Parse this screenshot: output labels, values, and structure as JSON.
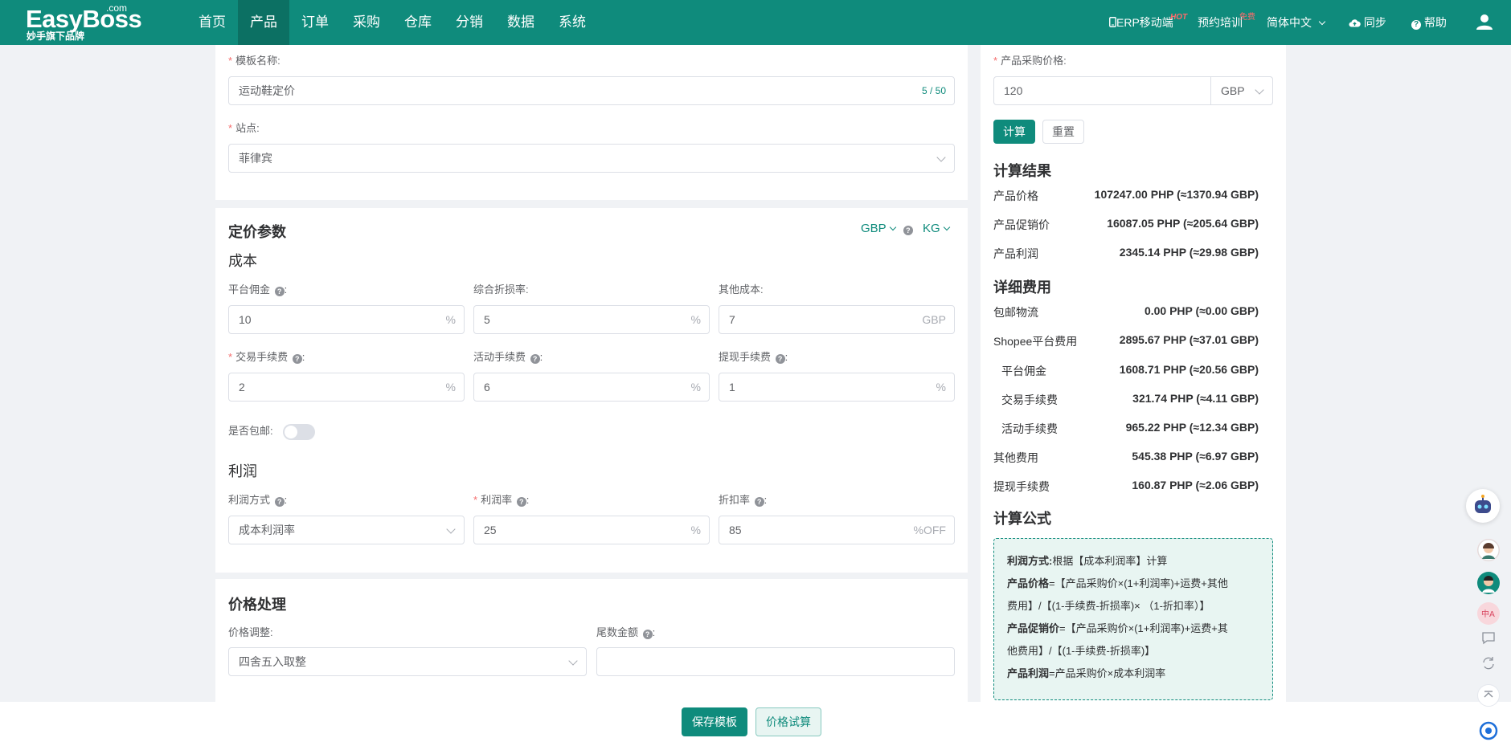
{
  "brand": {
    "name": "EasyBoss",
    "dotcom": ".com",
    "tagline": "妙手旗下品牌"
  },
  "nav": {
    "items": [
      "首页",
      "产品",
      "订单",
      "采购",
      "仓库",
      "分销",
      "数据",
      "系统"
    ],
    "active": "产品"
  },
  "top_right": {
    "erp_mobile": "ERP移动端",
    "erp_badge": "HOT",
    "training": "预约培训",
    "training_badge": "免费",
    "language": "简体中文",
    "sync": "同步",
    "help": "帮助"
  },
  "template": {
    "name_label": "模板名称:",
    "name_value": "运动鞋定价",
    "name_count": "5 / 50",
    "site_label": "站点:",
    "site_value": "菲律宾"
  },
  "pricing": {
    "title": "定价参数",
    "currency": "GBP",
    "weight_unit": "KG",
    "cost_title": "成本",
    "platform_commission": {
      "label": "平台佣金",
      "value": "10",
      "unit": "%"
    },
    "loss_rate": {
      "label": "综合折损率:",
      "value": "5",
      "unit": "%"
    },
    "other_cost": {
      "label": "其他成本:",
      "value": "7",
      "unit": "GBP"
    },
    "transaction_fee": {
      "label": "交易手续费",
      "value": "2",
      "unit": "%"
    },
    "activity_fee": {
      "label": "活动手续费",
      "value": "6",
      "unit": "%"
    },
    "withdraw_fee": {
      "label": "提现手续费",
      "value": "1",
      "unit": "%"
    },
    "free_shipping_label": "是否包邮:",
    "free_shipping_on": false,
    "profit_title": "利润",
    "profit_method": {
      "label": "利润方式",
      "value": "成本利润率"
    },
    "profit_rate": {
      "label": "利润率",
      "value": "25",
      "unit": "%"
    },
    "discount_rate": {
      "label": "折扣率",
      "value": "85",
      "unit": "%OFF"
    }
  },
  "price_processing": {
    "title": "价格处理",
    "adjust_label": "价格调整:",
    "adjust_value": "四舍五入取整",
    "tail_label": "尾数金额",
    "tail_value": ""
  },
  "calculator": {
    "purchase_price_label": "产品采购价格:",
    "purchase_price_value": "120",
    "currency": "GBP",
    "calc_button": "计算",
    "reset_button": "重置",
    "result_title": "计算结果",
    "results": [
      {
        "label": "产品价格",
        "value": "107247.00 PHP (≈1370.94 GBP)"
      },
      {
        "label": "产品促销价",
        "value": "16087.05 PHP (≈205.64 GBP)"
      },
      {
        "label": "产品利润",
        "value": "2345.14 PHP (≈29.98 GBP)"
      }
    ],
    "detail_title": "详细费用",
    "details": [
      {
        "label": "包邮物流",
        "value": "0.00 PHP (≈0.00 GBP)",
        "indent": false
      },
      {
        "label": "Shopee平台费用",
        "value": "2895.67 PHP (≈37.01 GBP)",
        "indent": false
      },
      {
        "label": "平台佣金",
        "value": "1608.71 PHP (≈20.56 GBP)",
        "indent": true
      },
      {
        "label": "交易手续费",
        "value": "321.74 PHP (≈4.11 GBP)",
        "indent": true
      },
      {
        "label": "活动手续费",
        "value": "965.22 PHP (≈12.34 GBP)",
        "indent": true
      },
      {
        "label": "其他费用",
        "value": "545.38 PHP (≈6.97 GBP)",
        "indent": false
      },
      {
        "label": "提现手续费",
        "value": "160.87 PHP (≈2.06 GBP)",
        "indent": false
      }
    ],
    "formula_title": "计算公式",
    "formula": {
      "profit_method_key": "利润方式:",
      "profit_method_text": "根据【成本利润率】计算",
      "price_key": "产品价格",
      "price_text_1": "=【产品采购价×(1+利润率)+运费+其他",
      "price_text_2": "费用】/【(1-手续费-折损率)× （1-折扣率）】",
      "promo_key": "产品促销价",
      "promo_text_1": "=【产品采购价×(1+利润率)+运费+其",
      "promo_text_2": "他费用】/【(1-手续费-折损率)】",
      "profit_key": "产品利润",
      "profit_text": "=产品采购价×成本利润率"
    }
  },
  "footer": {
    "save_button": "保存模板",
    "trial_button": "价格试算"
  },
  "colors": {
    "primary": "#0f8b7c",
    "primary_dark": "#0c7063",
    "required": "#f56c6c"
  }
}
